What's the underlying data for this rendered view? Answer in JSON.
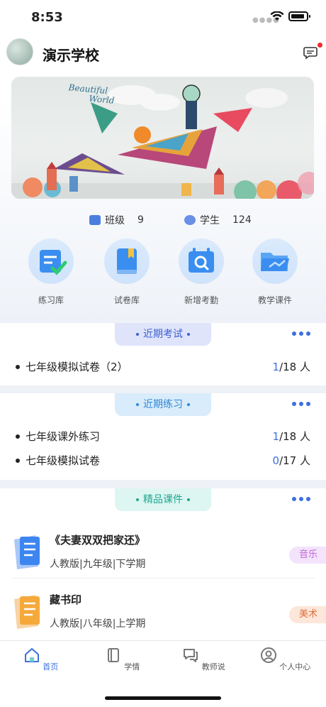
{
  "status_bar": {
    "time": "8:53"
  },
  "header": {
    "school_name": "演示学校",
    "message_icon": "chat-bubble-icon",
    "has_unread": true
  },
  "banner": {
    "text_line1": "Beautiful",
    "text_line2": "World"
  },
  "stats": {
    "class_label": "班级",
    "class_value": "9",
    "student_label": "学生",
    "student_value": "124"
  },
  "quick_actions": [
    {
      "label": "练习库",
      "icon": "practice-library-icon"
    },
    {
      "label": "试卷库",
      "icon": "paper-library-icon"
    },
    {
      "label": "新增考勤",
      "icon": "attendance-icon"
    },
    {
      "label": "教学课件",
      "icon": "courseware-folder-icon"
    }
  ],
  "exams": {
    "title": "近期考试",
    "items": [
      {
        "name": "七年级模拟试卷（2）",
        "done": "1",
        "total": "/18 人"
      }
    ]
  },
  "practices": {
    "title": "近期练习",
    "items": [
      {
        "name": "七年级课外练习",
        "done": "1",
        "total": "/18 人"
      },
      {
        "name": "七年级模拟试卷",
        "done": "0",
        "total": "/17 人"
      }
    ]
  },
  "courses": {
    "title": "精品课件",
    "items": [
      {
        "title": "《夫妻双双把家还》",
        "meta": "人教版|九年级|下学期",
        "tag": "音乐"
      },
      {
        "title": "藏书印",
        "meta": "人教版|八年级|上学期",
        "tag": "美术"
      }
    ]
  },
  "tabbar": [
    {
      "label": "首页",
      "active": true
    },
    {
      "label": "学情"
    },
    {
      "label": "教师说"
    },
    {
      "label": "个人中心"
    }
  ],
  "colors": {
    "accent": "#3d6fe0",
    "music_tag": "#c06ad8",
    "art_tag": "#e0703c"
  }
}
